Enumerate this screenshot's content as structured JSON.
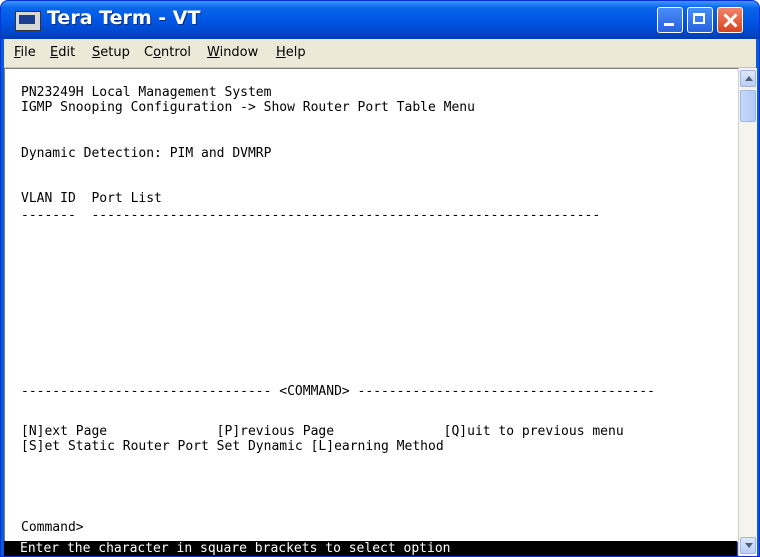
{
  "window": {
    "title": "Tera Term - VT"
  },
  "menu": {
    "items": [
      {
        "pre": "",
        "ul": "F",
        "post": "ile"
      },
      {
        "pre": "",
        "ul": "E",
        "post": "dit"
      },
      {
        "pre": "",
        "ul": "S",
        "post": "etup"
      },
      {
        "pre": "C",
        "ul": "o",
        "post": "ntrol"
      },
      {
        "pre": "",
        "ul": "W",
        "post": "indow"
      },
      {
        "pre": "",
        "ul": "H",
        "post": "elp"
      }
    ]
  },
  "terminal": {
    "system_name": "PN23249H Local Management System",
    "breadcrumb": "IGMP Snooping Configuration -> Show Router Port Table Menu",
    "detection": "Dynamic Detection: PIM and DVMRP",
    "table_header": "VLAN ID  Port List",
    "table_divider": "-------  -----------------------------------------------------------------",
    "command_divider": "-------------------------------- <COMMAND> --------------------------------------",
    "cmd_line1": "[N]ext Page              [P]revious Page              [Q]uit to previous menu",
    "cmd_line2": "[S]et Static Router Port Set Dynamic [L]earning Method",
    "prompt": "Command>"
  },
  "status": {
    "text": "Enter the character in square brackets to select option"
  },
  "icons": {
    "app": "terminal-app-icon",
    "minimize": "minimize-icon",
    "maximize": "maximize-icon",
    "close": "close-icon"
  }
}
